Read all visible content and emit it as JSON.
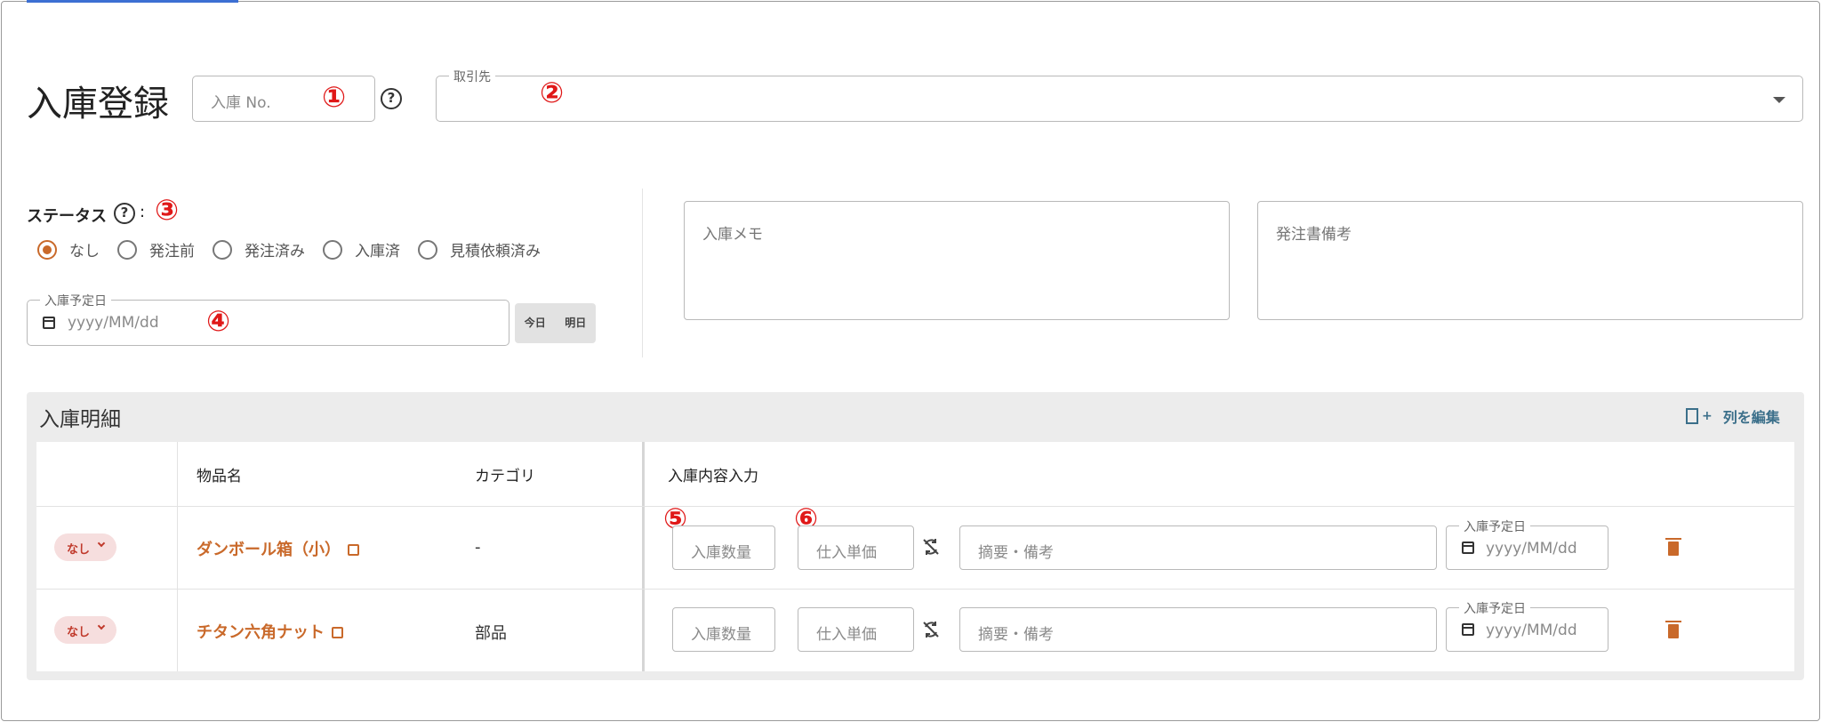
{
  "header": {
    "title": "入庫登録",
    "receipt_no_placeholder": "入庫 No.",
    "help_icon": "question-circle-icon",
    "supplier_label": "取引先",
    "supplier_value": ""
  },
  "annotations": [
    "①",
    "②",
    "③",
    "④",
    "⑤",
    "⑥"
  ],
  "status": {
    "label": "ステータス",
    "colon": ":",
    "options": [
      "なし",
      "発注前",
      "発注済み",
      "入庫済",
      "見積依頼済み"
    ],
    "selected": "なし"
  },
  "scheduled_date": {
    "label": "入庫予定日",
    "placeholder": "yyyy/MM/dd",
    "today_label": "今日",
    "tomorrow_label": "明日"
  },
  "memo": {
    "receipt_memo_label": "入庫メモ",
    "order_note_label": "発注書備考"
  },
  "detail": {
    "title": "入庫明細",
    "edit_columns_label": "列を編集",
    "columns": [
      "物品名",
      "カテゴリ",
      "入庫内容入力"
    ],
    "rows": [
      {
        "status": "なし",
        "name": "ダンボール箱（小）",
        "category": "-",
        "qty_placeholder": "入庫数量",
        "price_placeholder": "仕入単価",
        "note_placeholder": "摘要・備考",
        "date_label": "入庫予定日",
        "date_placeholder": "yyyy/MM/dd"
      },
      {
        "status": "なし",
        "name": "チタン六角ナット",
        "category": "部品",
        "qty_placeholder": "入庫数量",
        "price_placeholder": "仕入単価",
        "note_placeholder": "摘要・備考",
        "date_label": "入庫予定日",
        "date_placeholder": "yyyy/MM/dd"
      }
    ]
  },
  "colors": {
    "accent": "#c9692a",
    "annotation": "#e01818",
    "pill_bg": "#f6dede",
    "link_teal": "#3b6f8a"
  }
}
